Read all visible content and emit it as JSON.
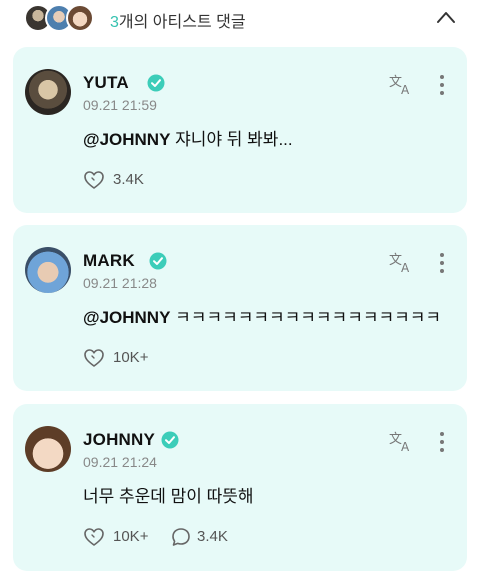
{
  "header": {
    "count": "3",
    "title_suffix": "개의 아티스트 댓글"
  },
  "colors": {
    "accent": "#35c2b0",
    "card_bg": "#e7faf8",
    "verified": "#3ccdb9"
  },
  "comments": [
    {
      "name": "YUTA",
      "time": "09.21 21:59",
      "mention": "@JOHNNY",
      "text": " 쟈니야 뒤 봐봐...",
      "likes": "3.4K",
      "icons": [
        "verified-icon",
        "translate-icon",
        "more-icon",
        "heart-icon"
      ]
    },
    {
      "name": "MARK",
      "time": "09.21 21:28",
      "mention": "@JOHNNY",
      "text": " ㅋㅋㅋㅋㅋㅋㅋㅋㅋㅋㅋㅋㅋㅋㅋㅋㅋ",
      "likes": "10K+",
      "icons": [
        "verified-icon",
        "translate-icon",
        "more-icon",
        "heart-icon"
      ]
    },
    {
      "name": "JOHNNY",
      "time": "09.21 21:24",
      "text": "너무 추운데 맘이 따뜻해",
      "likes": "10K+",
      "replies": "3.4K",
      "icons": [
        "verified-icon",
        "translate-icon",
        "more-icon",
        "heart-icon",
        "comment-icon"
      ]
    }
  ]
}
